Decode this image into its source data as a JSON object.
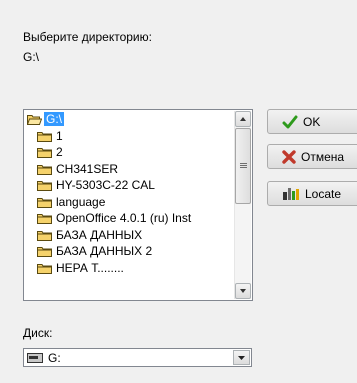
{
  "prompt_label": "Выберите директорию:",
  "current_path": "G:\\",
  "directory_list": {
    "items": [
      {
        "label": "G:\\",
        "selected": true
      },
      {
        "label": "1"
      },
      {
        "label": "2"
      },
      {
        "label": "CH341SER"
      },
      {
        "label": "HY-5303C-22  CAL"
      },
      {
        "label": "language"
      },
      {
        "label": "OpenOffice 4.0.1 (ru) Inst"
      },
      {
        "label": "БАЗА ДАННЫХ"
      },
      {
        "label": "БАЗА ДАННЫХ 2"
      },
      {
        "label": "НЕРА Т........"
      }
    ]
  },
  "drive_label": "Диск:",
  "drive_value": "G:",
  "buttons": {
    "ok_label": "OK",
    "cancel_label": "Отмена",
    "locate_label": "Locate"
  },
  "colors": {
    "selection": "#3399ff",
    "folder": "#f5d26b",
    "ok_check": "#2e9a1c",
    "cancel_x": "#c0392b"
  }
}
